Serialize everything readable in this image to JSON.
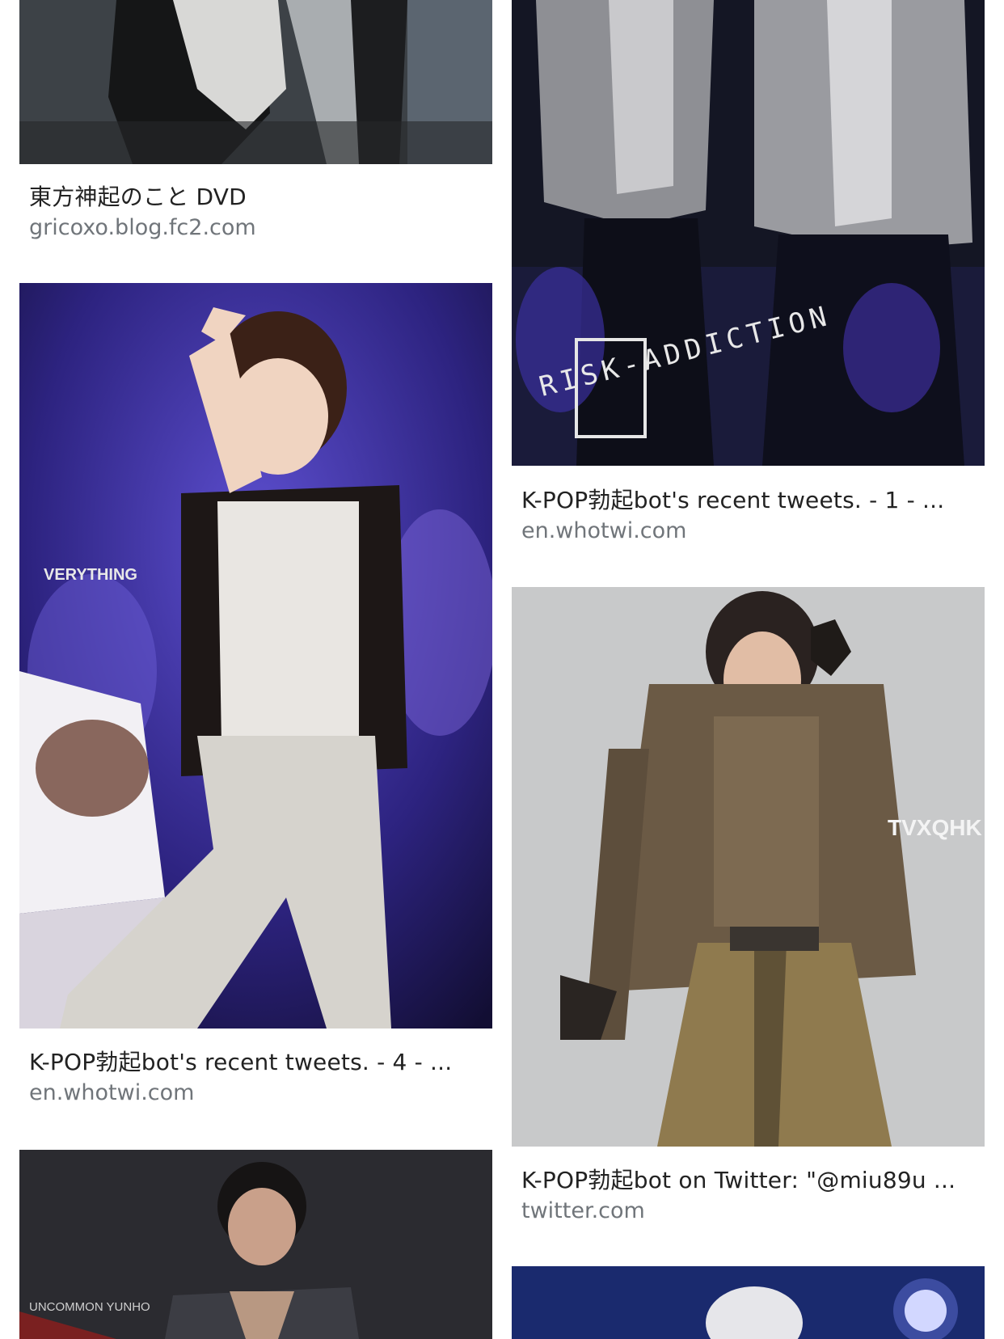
{
  "results": [
    {
      "title": "東方神起のこと DVD",
      "source": "gricoxo.blog.fc2.com"
    },
    {
      "title": "K-POP勃起bot's recent tweets. - 1 - ...",
      "source": "en.whotwi.com",
      "watermark": "RISK-ADDICTION"
    },
    {
      "title": "K-POP勃起bot's recent tweets. - 4 - ...",
      "source": "en.whotwi.com",
      "watermark": "VERYTHING"
    },
    {
      "title": "K-POP勃起bot on Twitter: \"@miu89u ...",
      "source": "twitter.com",
      "watermark": "TVXQHK"
    },
    {
      "title": "",
      "source": "",
      "watermark": "UNCOMMON YUNHO"
    },
    {
      "title": "",
      "source": ""
    }
  ]
}
